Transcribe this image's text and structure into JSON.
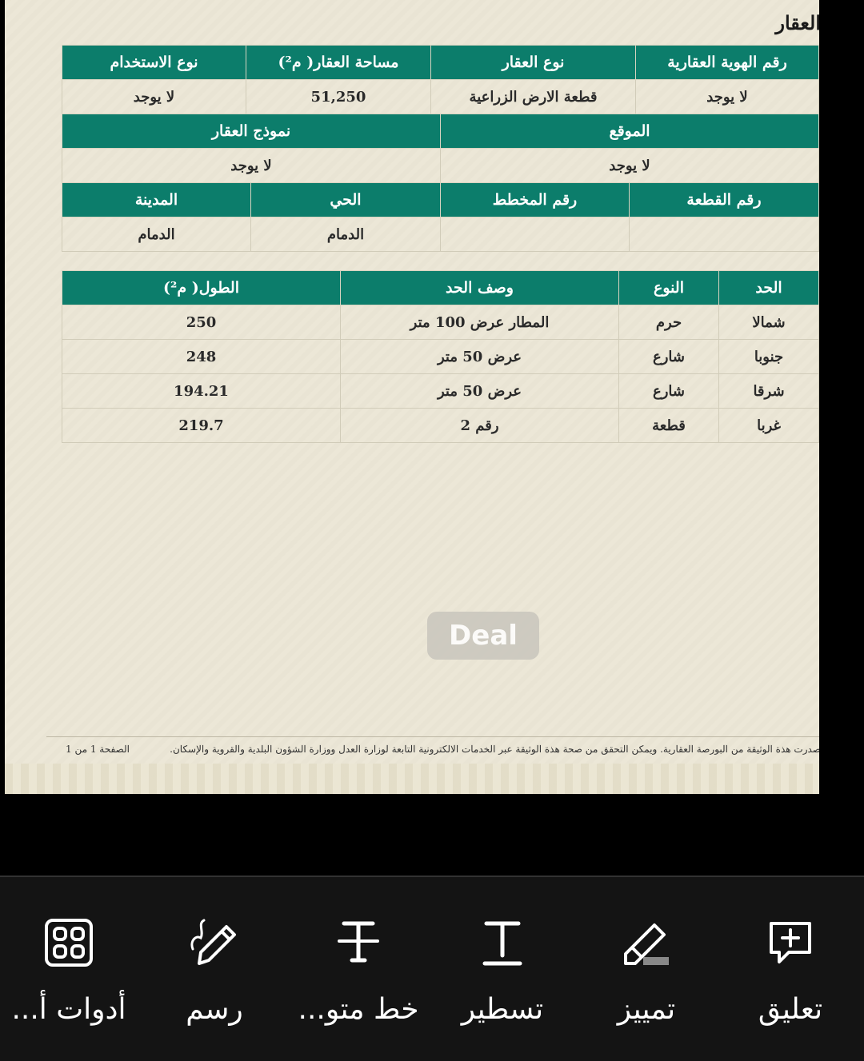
{
  "document": {
    "section_title": "العقار",
    "table1": {
      "headers": [
        "رقم الهوية العقارية",
        "نوع العقار",
        "مساحة العقار( م²)",
        "نوع الاستخدام"
      ],
      "values": [
        "لا يوجد",
        "قطعة الارض الزراعية",
        "51,250",
        "لا يوجد"
      ]
    },
    "table2": {
      "headers": [
        "الموقع",
        "نموذج العقار"
      ],
      "values": [
        "لا يوجد",
        "لا يوجد"
      ]
    },
    "table3": {
      "headers": [
        "رقم القطعة",
        "رقم المخطط",
        "الحي",
        "المدينة"
      ],
      "values": [
        "",
        "",
        "الدمام",
        "الدمام"
      ]
    },
    "boundaries": {
      "headers": [
        "الحد",
        "النوع",
        "وصف الحد",
        "الطول( م²)"
      ],
      "rows": [
        [
          "شمالا",
          "حرم",
          "المطار عرض 100 متر",
          "250"
        ],
        [
          "جنوبا",
          "شارع",
          "عرض 50 متر",
          "248"
        ],
        [
          "شرقا",
          "شارع",
          "عرض 50 متر",
          "194.21"
        ],
        [
          "غربا",
          "قطعة",
          "رقم 2",
          "219.7"
        ]
      ]
    },
    "watermark": "Deal",
    "footer_note": "صدرت هذة الوثيقة من البورصة العقارية. ويمكن التحقق من صحة هذة الوثيقة عبر الخدمات الالكترونية التابعة لوزارة العدل ووزارة الشؤون البلدية والقروية والإسكان.",
    "footer_page": "الصفحة 1 من 1"
  },
  "toolbar": {
    "comment": "تعليق",
    "highlight": "تمييز",
    "underline": "تسطير",
    "strikethrough": "خط متو...",
    "draw": "رسم",
    "more_tools": "أدوات أ..."
  },
  "colors": {
    "header_green": "#0c7d6b",
    "paper": "#ece7d6",
    "toolbar_bg": "#141414"
  },
  "icons": [
    "comment-plus-icon",
    "highlighter-icon",
    "text-underline-icon",
    "strikethrough-icon",
    "pen-draw-icon",
    "grid-tools-icon"
  ]
}
